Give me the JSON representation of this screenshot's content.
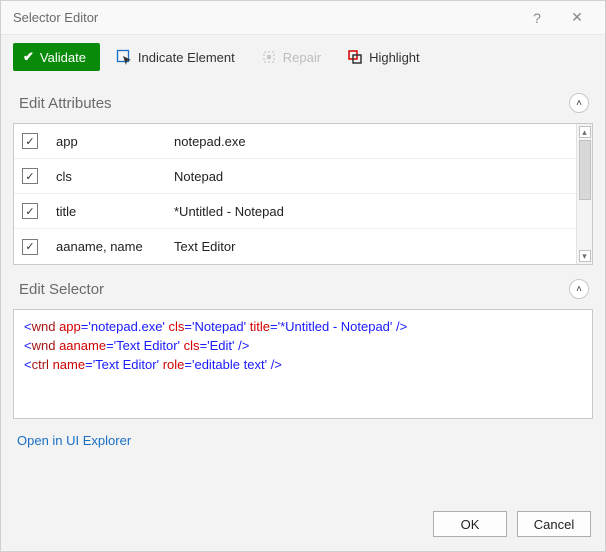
{
  "window": {
    "title": "Selector Editor"
  },
  "toolbar": {
    "validate": "Validate",
    "indicate": "Indicate Element",
    "repair": "Repair",
    "highlight": "Highlight"
  },
  "sections": {
    "attributes_title": "Edit Attributes",
    "selector_title": "Edit Selector"
  },
  "attributes": [
    {
      "checked": true,
      "name": "app",
      "value": "notepad.exe"
    },
    {
      "checked": true,
      "name": "cls",
      "value": "Notepad"
    },
    {
      "checked": true,
      "name": "title",
      "value": "*Untitled - Notepad"
    },
    {
      "checked": true,
      "name": "aaname, name",
      "value": "Text Editor"
    }
  ],
  "selector_lines": [
    {
      "tag": "wnd",
      "attrs": [
        {
          "k": "app",
          "v": "notepad.exe"
        },
        {
          "k": "cls",
          "v": "Notepad"
        },
        {
          "k": "title",
          "v": "*Untitled - Notepad"
        }
      ]
    },
    {
      "tag": "wnd",
      "attrs": [
        {
          "k": "aaname",
          "v": "Text Editor"
        },
        {
          "k": "cls",
          "v": "Edit"
        }
      ]
    },
    {
      "tag": "ctrl",
      "attrs": [
        {
          "k": "name",
          "v": "Text Editor"
        },
        {
          "k": "role",
          "v": "editable text"
        }
      ]
    }
  ],
  "link_open": "Open in UI Explorer",
  "footer": {
    "ok": "OK",
    "cancel": "Cancel"
  }
}
